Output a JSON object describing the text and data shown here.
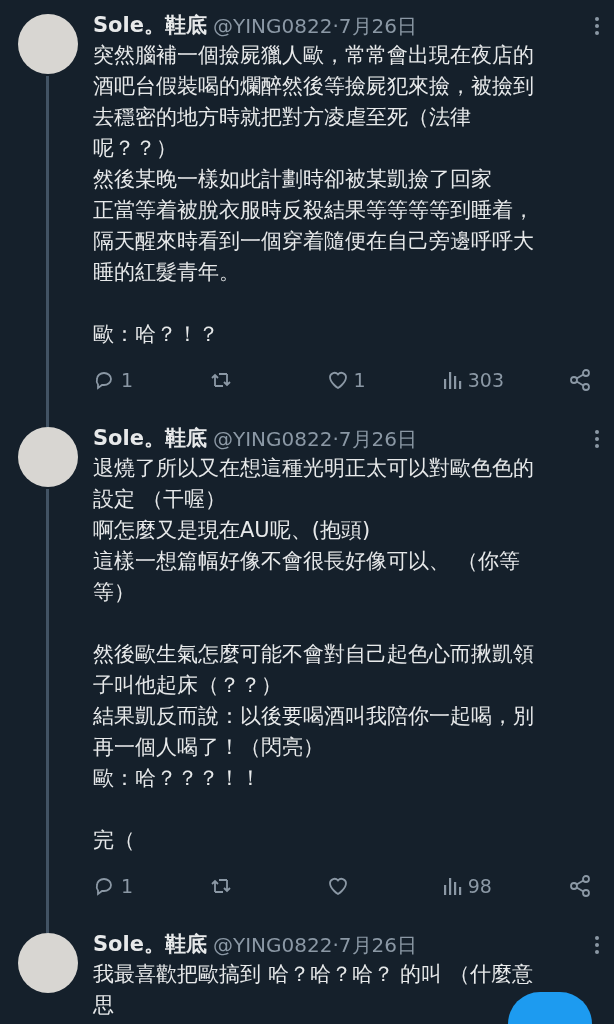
{
  "tweets": [
    {
      "name": "Sole。鞋底",
      "handle": "@YING0822",
      "date": "·7月26日",
      "paragraphs": [
        [
          "突然腦補一個撿屍獵人歐，常常會出現在夜店的",
          "酒吧台假裝喝的爛醉然後等撿屍犯來撿，被撿到",
          "去穩密的地方時就把對方凌虐至死（法律",
          "呢？？）",
          "然後某晚一樣如此計劃時卻被某凱撿了回家",
          "正當等着被脫衣服時反殺結果等等等等到睡着，",
          "隔天醒來時看到一個穿着隨便在自己旁邊呼呼大",
          "睡的紅髮青年。"
        ],
        [
          "歐：哈？！？"
        ]
      ],
      "replies": "1",
      "likes": "1",
      "views": "303",
      "thread_continues": true
    },
    {
      "name": "Sole。鞋底",
      "handle": "@YING0822",
      "date": "·7月26日",
      "paragraphs": [
        [
          "退燒了所以又在想這種光明正太可以對歐色色的",
          "設定 （干喔）",
          "啊怎麼又是現在AU呢、(抱頭)",
          "這樣一想篇幅好像不會很長好像可以、 （你等",
          "等）"
        ],
        [
          "然後歐生氣怎麼可能不會對自己起色心而揪凱領",
          "子叫他起床（？？）",
          "結果凱反而說：以後要喝酒叫我陪你一起喝，別",
          "再一個人喝了！（閃亮）",
          "歐：哈？？？！！"
        ],
        [
          "完（"
        ]
      ],
      "replies": "1",
      "views": "98",
      "thread_continues": true
    },
    {
      "name": "Sole。鞋底",
      "handle": "@YING0822",
      "date": "·7月26日",
      "paragraphs": [
        [
          "我最喜歡把歐搞到 哈？哈？哈？ 的叫 （什麼意",
          "思"
        ]
      ],
      "thread_continues": false
    }
  ]
}
